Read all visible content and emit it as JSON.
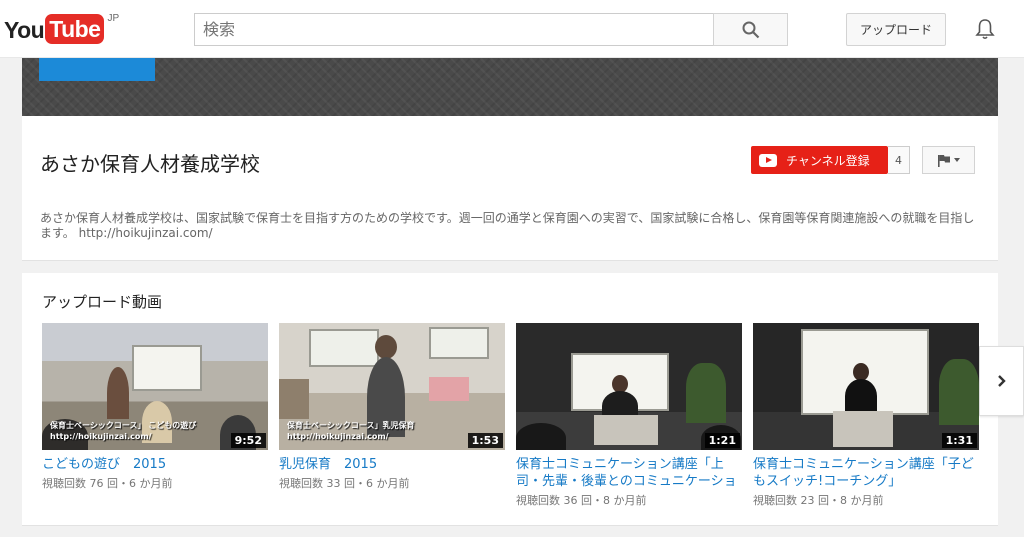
{
  "masthead": {
    "logo_you": "You",
    "logo_tube": "Tube",
    "logo_region": "JP",
    "search_placeholder": "検索",
    "search_icon": "search-icon",
    "upload_label": "アップロード",
    "notifications_icon": "bell-icon"
  },
  "channel": {
    "title": "あさか保育人材養成学校",
    "subscribe_label": "チャンネル登録",
    "subscriber_count": "4",
    "description": "あさか保育人材養成学校は、国家試験で保育士を目指す方のための学校です。週一回の通学と保育園への実習で、国家試験に合格し、保育園等保育関連施設への就職を目指します。 http://hoikujinzai.com/"
  },
  "colors": {
    "brand_red": "#e62117",
    "link_blue": "#167ac6",
    "banner_avatar_blue": "#1c8ad8"
  },
  "uploads": {
    "title": "アップロード動画",
    "videos": [
      {
        "title": "こどもの遊び　2015",
        "meta": "視聴回数 76 回・6 か月前",
        "duration": "9:52",
        "caption_line1": "保育士ベーシックコース」 こどもの遊び",
        "caption_line2": "http://hoikujinzai.com/"
      },
      {
        "title": "乳児保育　2015",
        "meta": "視聴回数 33 回・6 か月前",
        "duration": "1:53",
        "caption_line1": "保育士ベーシックコース」乳児保育",
        "caption_line2": "http://hoikujinzai.com/"
      },
      {
        "title": "保育士コミュニケーション講座「上司・先輩・後輩とのコミュニケーション」",
        "meta": "視聴回数 36 回・8 か月前",
        "duration": "1:21"
      },
      {
        "title": "保育士コミュニケーション講座「子どもスイッチ!コーチング」",
        "meta": "視聴回数 23 回・8 か月前",
        "duration": "1:31"
      }
    ]
  },
  "next_icon": "chevron-right-icon"
}
